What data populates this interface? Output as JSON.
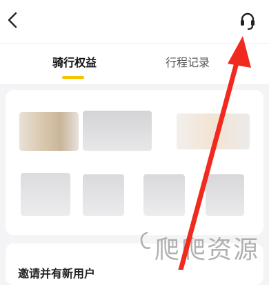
{
  "header": {
    "back_icon": "chevron-left-icon",
    "service_icon": "customer-service-headset-icon"
  },
  "tabs": [
    {
      "label": "骑行权益",
      "active": true
    },
    {
      "label": "行程记录",
      "active": false
    }
  ],
  "colors": {
    "accent": "#f6c400",
    "annotation_arrow": "#f02a1f",
    "background": "#f4f4f6"
  },
  "section2": {
    "title": "邀请并有新用户"
  },
  "watermark": {
    "text": "爬爬资源"
  }
}
